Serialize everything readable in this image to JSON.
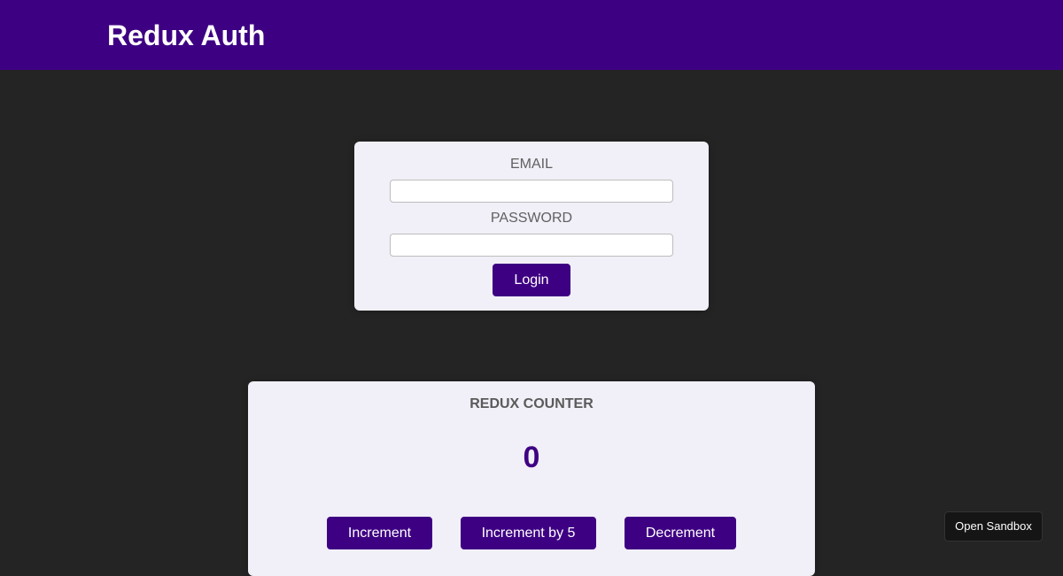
{
  "header": {
    "title": "Redux Auth"
  },
  "auth_form": {
    "email_label": "EMAIL",
    "email_value": "",
    "password_label": "PASSWORD",
    "password_value": "",
    "login_label": "Login"
  },
  "counter": {
    "title": "REDUX COUNTER",
    "value": "0",
    "increment_label": "Increment",
    "increment_by_5_label": "Increment by 5",
    "decrement_label": "Decrement"
  },
  "sandbox": {
    "open_label": "Open Sandbox"
  },
  "colors": {
    "brand": "#3e0083",
    "background": "#242424",
    "card": "#f1eff7"
  }
}
